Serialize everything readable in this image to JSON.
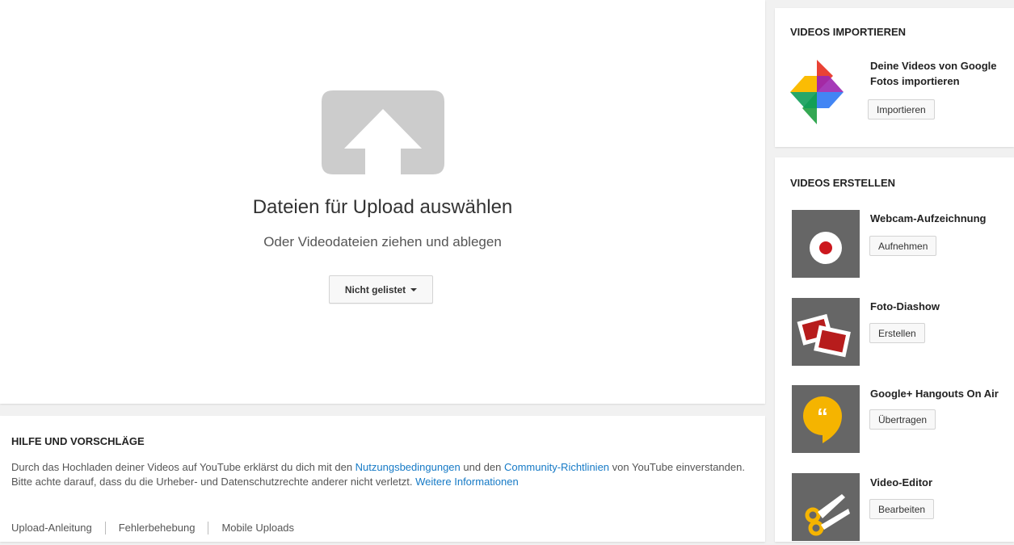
{
  "upload": {
    "title": "Dateien für Upload auswählen",
    "subtitle": "Oder Videodateien ziehen und ablegen",
    "privacy_label": "Nicht gelistet"
  },
  "help": {
    "title": "HILFE UND VORSCHLÄGE",
    "line1_a": "Durch das Hochladen deiner Videos auf YouTube erklärst du dich mit den ",
    "line1_link1": "Nutzungsbedingungen",
    "line1_b": " und den ",
    "line1_link2": "Community-Richtlinien",
    "line1_c": " von YouTube einverstanden.",
    "line2_a": "Bitte achte darauf, dass du die Urheber- und Datenschutzrechte anderer nicht verletzt. ",
    "line2_link": "Weitere Informationen",
    "links": [
      "Upload-Anleitung",
      "Fehlerbehebung",
      "Mobile Uploads"
    ]
  },
  "import": {
    "title": "VIDEOS IMPORTIEREN",
    "item_title": "Deine Videos von Google Fotos importieren",
    "button": "Importieren"
  },
  "create": {
    "title": "VIDEOS ERSTELLEN",
    "items": [
      {
        "title": "Webcam-Aufzeichnung",
        "button": "Aufnehmen",
        "icon": "record-icon"
      },
      {
        "title": "Foto-Diashow",
        "button": "Erstellen",
        "icon": "photos-icon"
      },
      {
        "title": "Google+ Hangouts On Air",
        "button": "Übertragen",
        "icon": "hangouts-icon"
      },
      {
        "title": "Video-Editor",
        "button": "Bearbeiten",
        "icon": "scissors-icon"
      }
    ]
  },
  "colors": {
    "link": "#167ac6",
    "icon_gray": "#cccccc",
    "tile_gray": "#666666",
    "record_red": "#cc181e",
    "hangouts_yellow": "#f5b400"
  }
}
